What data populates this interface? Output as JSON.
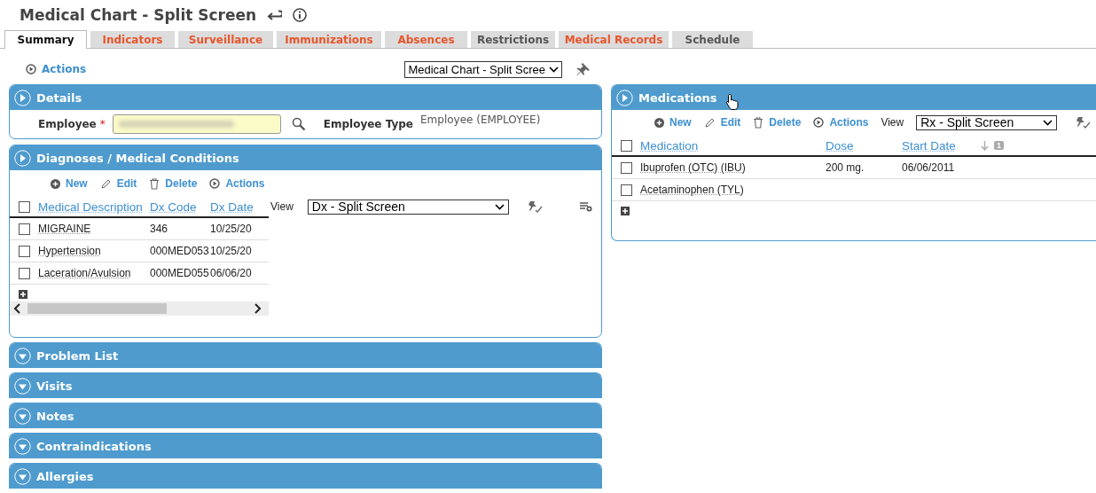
{
  "title": "Medical Chart - Split Screen",
  "tabs": [
    {
      "label": "Summary",
      "selected": true,
      "highlighted": false
    },
    {
      "label": "Indicators",
      "selected": false,
      "highlighted": true
    },
    {
      "label": "Surveillance",
      "selected": false,
      "highlighted": true
    },
    {
      "label": "Immunizations",
      "selected": false,
      "highlighted": true
    },
    {
      "label": "Absences",
      "selected": false,
      "highlighted": true
    },
    {
      "label": "Restrictions",
      "selected": false,
      "highlighted": false
    },
    {
      "label": "Medical Records",
      "selected": false,
      "highlighted": true
    },
    {
      "label": "Schedule",
      "selected": false,
      "highlighted": false
    }
  ],
  "actions_label": "Actions",
  "layout_select": "Medical Chart - Split Scree",
  "details": {
    "title": "Details",
    "expanded": true,
    "employee_label": "Employee",
    "required_mark": "*",
    "employee_type_label": "Employee Type",
    "employee_type": "Employee (EMPLOYEE)"
  },
  "diagnoses": {
    "title": "Diagnoses / Medical Conditions",
    "expanded": true,
    "toolbar": [
      {
        "kind": "new",
        "label": "New"
      },
      {
        "kind": "edit",
        "label": "Edit"
      },
      {
        "kind": "delete",
        "label": "Delete"
      },
      {
        "kind": "actions",
        "label": "Actions"
      }
    ],
    "view_label": "View",
    "view_select": "Dx - Split Screen",
    "header_checked": false,
    "columns": [
      "Medical Description",
      "Dx Code",
      "Dx Date"
    ],
    "rows": [
      {
        "checked": false,
        "cells": [
          "MIGRAINE",
          "346",
          "10/25/20"
        ]
      },
      {
        "checked": false,
        "cells": [
          "Hypertension",
          "000MED053",
          "10/25/20"
        ]
      },
      {
        "checked": false,
        "cells": [
          "Laceration/Avulsion",
          "000MED055",
          "06/06/20"
        ]
      }
    ]
  },
  "medications": {
    "title": "Medications",
    "expanded": true,
    "toolbar": [
      {
        "kind": "new",
        "label": "New"
      },
      {
        "kind": "edit",
        "label": "Edit"
      },
      {
        "kind": "delete",
        "label": "Delete"
      },
      {
        "kind": "actions",
        "label": "Actions"
      }
    ],
    "view_label": "View",
    "view_select": "Rx - Split Screen",
    "header_checked": false,
    "columns": [
      "Medication",
      "Dose",
      "Start Date"
    ],
    "sort_badge": "1",
    "rows": [
      {
        "checked": false,
        "cells": [
          "Ibuprofen (OTC) (IBU)",
          "200 mg.",
          "06/06/2011"
        ]
      },
      {
        "checked": false,
        "cells": [
          "Acetaminophen (TYL)",
          "",
          ""
        ]
      }
    ]
  },
  "collapsed_panels": [
    {
      "title": "Problem List",
      "expanded": false
    },
    {
      "title": "Visits",
      "expanded": false
    },
    {
      "title": "Notes",
      "expanded": false
    },
    {
      "title": "Contraindications",
      "expanded": false
    },
    {
      "title": "Allergies",
      "expanded": false
    }
  ]
}
